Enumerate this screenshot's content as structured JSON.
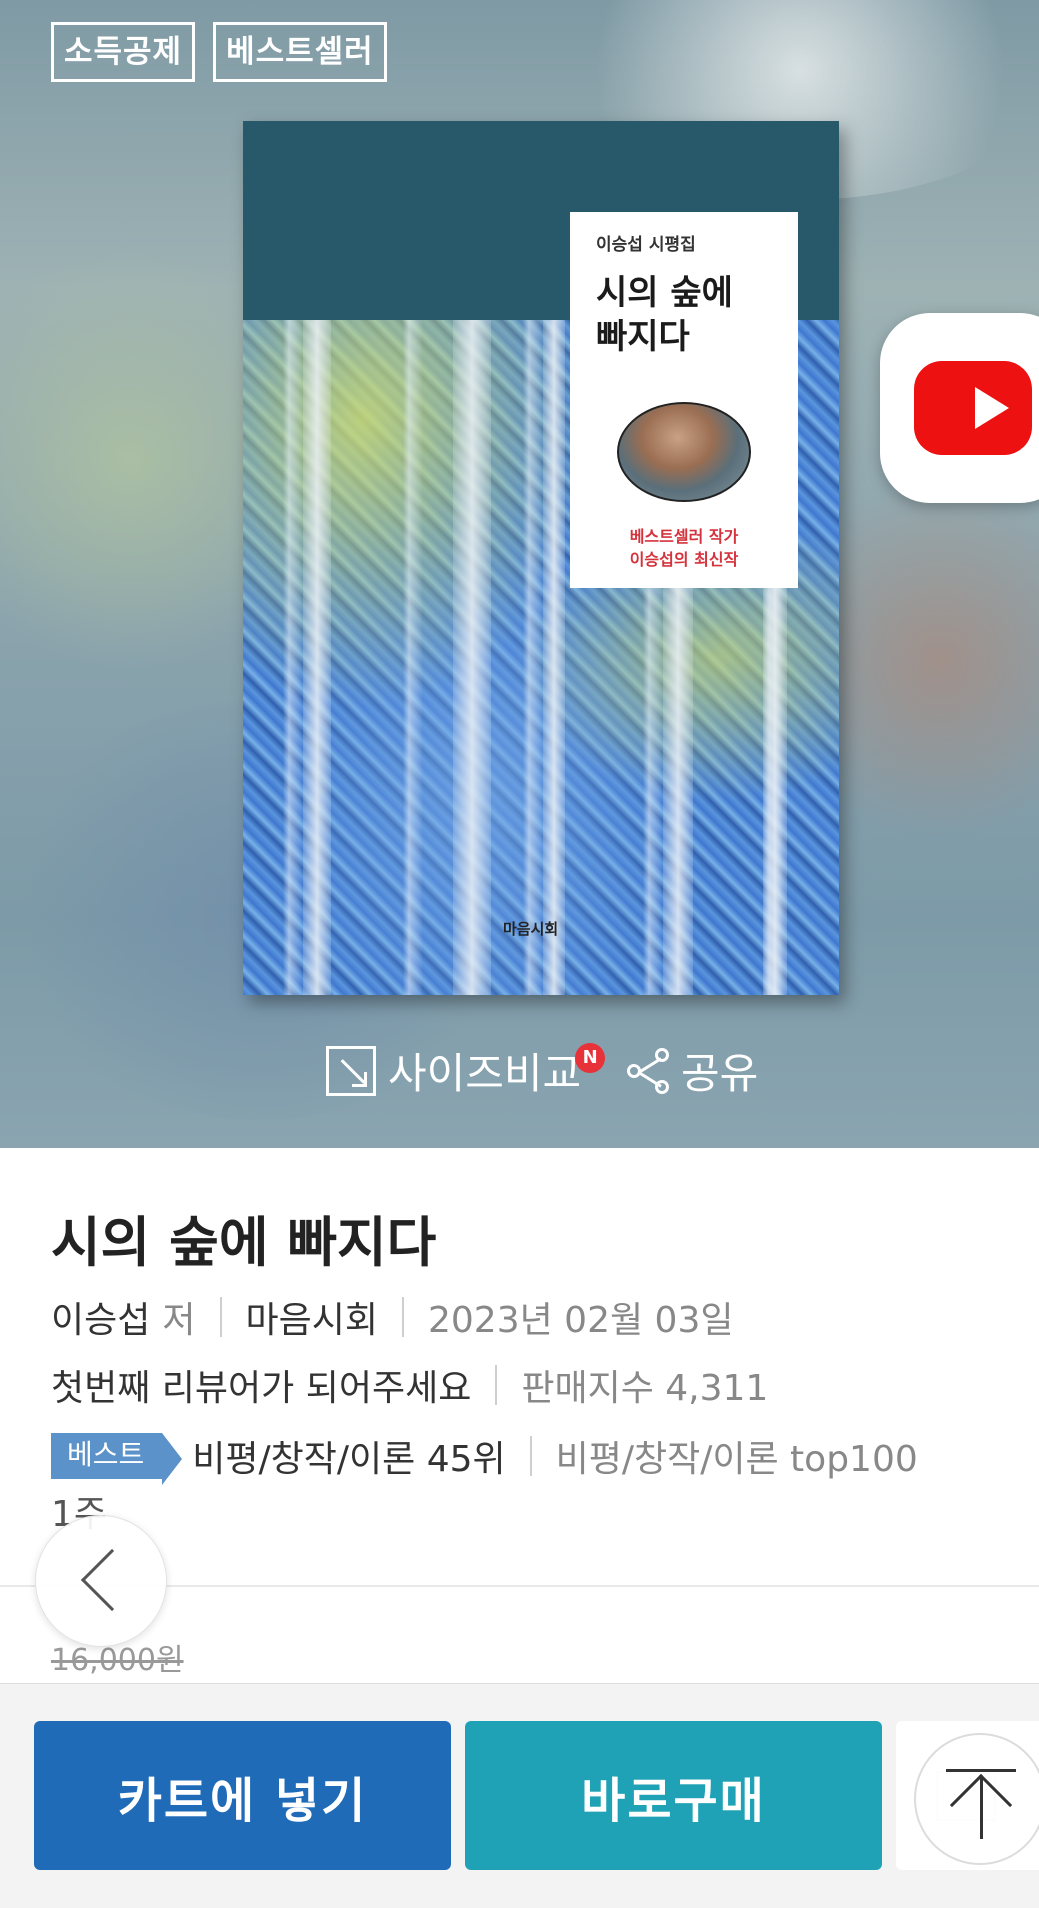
{
  "badges": [
    "소득공제",
    "베스트셀러"
  ],
  "cover": {
    "series": "이승섭 시평집",
    "title_line1": "시의 숲에",
    "title_line2": "빠지다",
    "tagline1": "베스트셀러 작가",
    "tagline2": "이승섭의 최신작",
    "publisher_mark": "마음시회"
  },
  "tools": {
    "size_compare": "사이즈비교",
    "new_badge": "N",
    "share": "공유"
  },
  "book": {
    "title": "시의 숲에 빠지다",
    "author": "이승섭",
    "author_role": "저",
    "publisher": "마음시회",
    "date": "2023년 02월 03일",
    "review_prompt": "첫번째 리뷰어가 되어주세요",
    "sales_index": "판매지수 4,311",
    "best_badge": "베스트",
    "rank": "비평/창작/이론 45위",
    "top100": "비평/창작/이론 top100",
    "top100_weeks": "1주",
    "list_price": "16,000원"
  },
  "actions": {
    "cart": "카트에 넣기",
    "buy_now": "바로구매"
  },
  "colors": {
    "cart_button": "#1f6bb8",
    "buy_button": "#1fa2b6",
    "best_badge": "#5b92c9",
    "youtube_red": "#ee1111"
  }
}
